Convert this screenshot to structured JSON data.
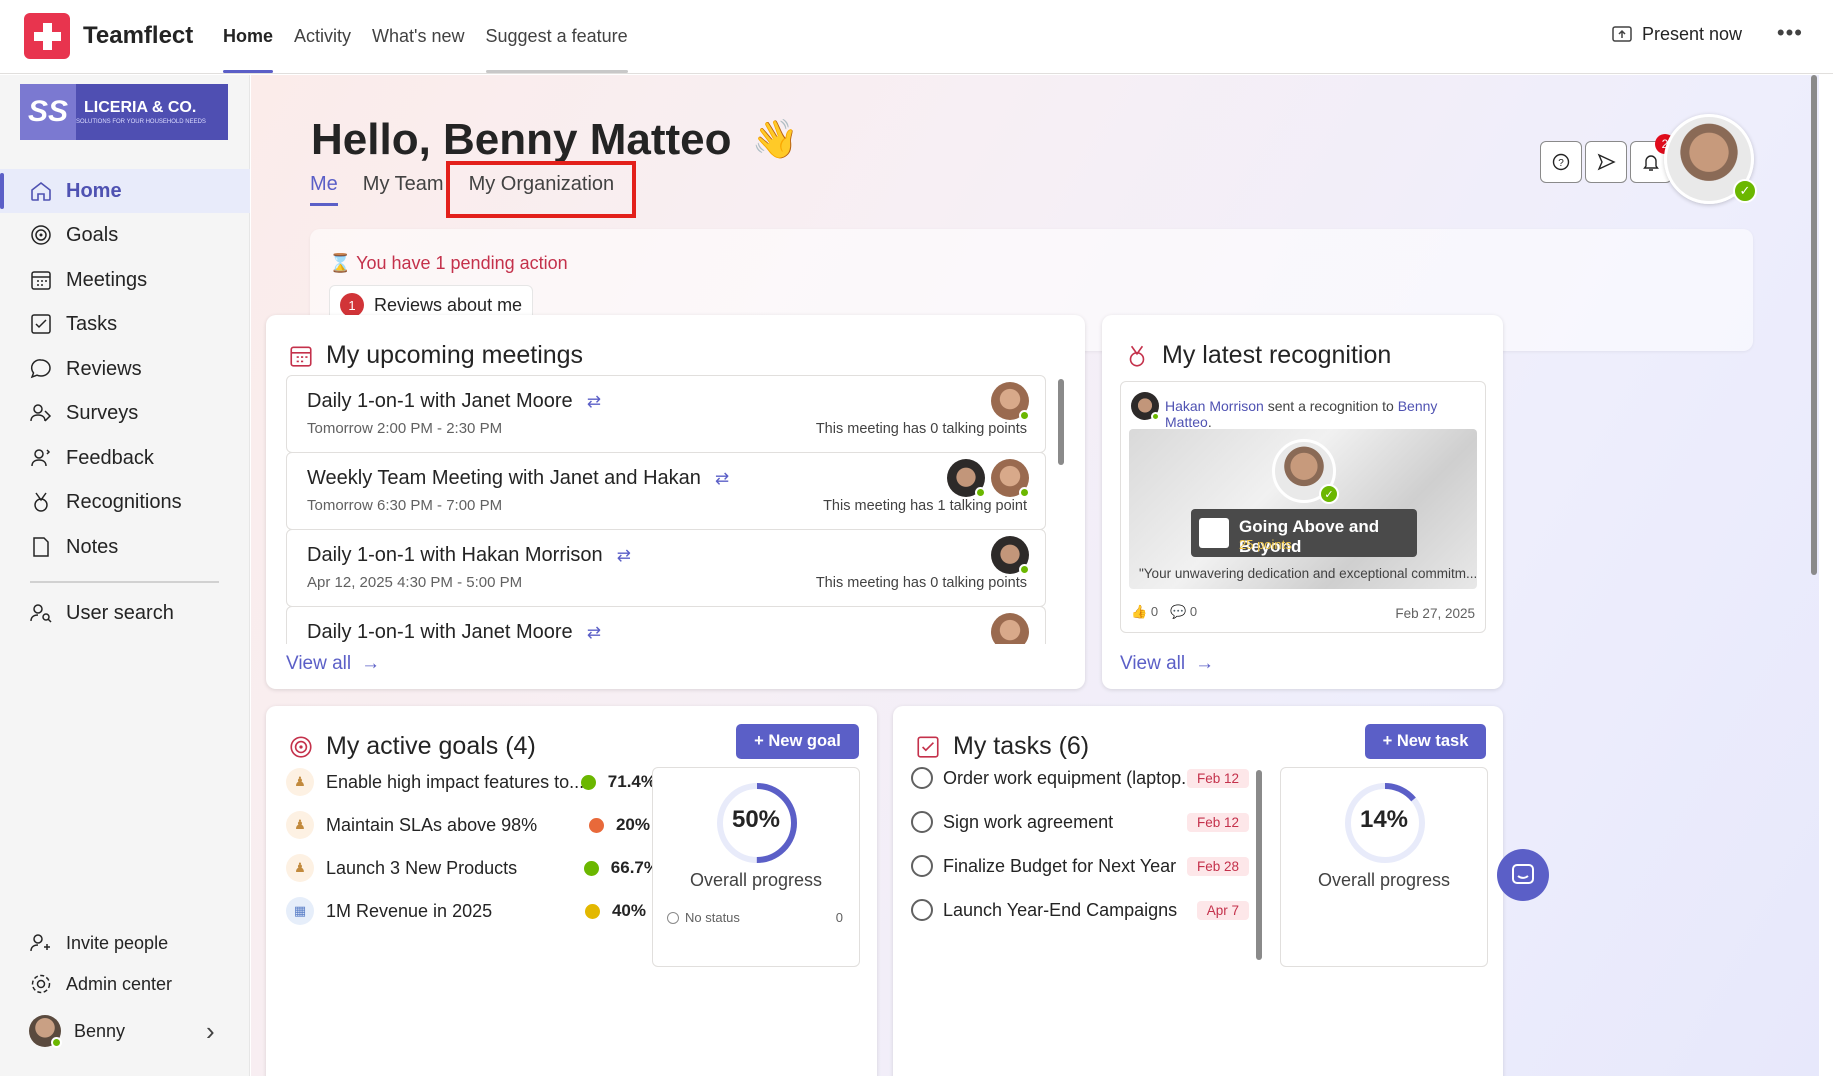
{
  "app": {
    "name": "Teamflect"
  },
  "topnav": {
    "items": [
      "Home",
      "Activity",
      "What's new",
      "Suggest a feature"
    ],
    "present": "Present now",
    "more": "•••"
  },
  "org": {
    "initials": "SS",
    "name": "LICERIA & CO.",
    "tagline": "SOLUTIONS FOR YOUR HOUSEHOLD NEEDS"
  },
  "sidebar": {
    "items": [
      "Home",
      "Goals",
      "Meetings",
      "Tasks",
      "Reviews",
      "Surveys",
      "Feedback",
      "Recognitions",
      "Notes"
    ],
    "user_search": "User search",
    "invite": "Invite people",
    "admin": "Admin center",
    "user": "Benny",
    "chevron": "›"
  },
  "header": {
    "greeting": "Hello, Benny Matteo",
    "wave": "👋",
    "tabs": [
      "Me",
      "My Team",
      "My Organization"
    ],
    "notifications": "2",
    "help": "?"
  },
  "pending": {
    "title": "You have 1 pending action",
    "count": "1",
    "label": "Reviews about me"
  },
  "meetings": {
    "title": "My upcoming meetings",
    "items": [
      {
        "title": "Daily 1-on-1 with Janet Moore",
        "time": "Tomorrow 2:00 PM - 2:30 PM",
        "note": "This meeting has 0 talking points"
      },
      {
        "title": "Weekly Team Meeting with Janet and Hakan",
        "time": "Tomorrow 6:30 PM - 7:00 PM",
        "note": "This meeting has 1 talking point"
      },
      {
        "title": "Daily 1-on-1 with Hakan Morrison",
        "time": "Apr 12, 2025 4:30 PM - 5:00 PM",
        "note": "This meeting has 0 talking points"
      },
      {
        "title": "Daily 1-on-1 with Janet Moore",
        "time": "",
        "note": ""
      }
    ],
    "view_all": "View all",
    "arrow": "→"
  },
  "recognition": {
    "title": "My latest recognition",
    "sender": "Hakan Morrison",
    "middle": " sent a recognition to ",
    "recipient": "Benny Matteo",
    "end": ".",
    "badge_title": "Going Above and Beyond",
    "points": "25 points",
    "quote": "\"Your unwavering dedication and exceptional commitm...",
    "likes": "0",
    "comments": "0",
    "date": "Feb 27, 2025",
    "view_all": "View all"
  },
  "goals": {
    "title": "My active goals (4)",
    "new_label": "+ New goal",
    "items": [
      {
        "name": "Enable high impact features to...",
        "pct": "71.4%",
        "color": "#6bb700"
      },
      {
        "name": "Maintain SLAs above 98%",
        "pct": "20%",
        "color": "#e8693a"
      },
      {
        "name": "Launch 3 New Products",
        "pct": "66.7%",
        "color": "#6bb700"
      },
      {
        "name": "1M Revenue in 2025",
        "pct": "40%",
        "color": "#e3b800"
      }
    ],
    "overall": "50%",
    "overall_value": 0.5,
    "overall_label": "Overall progress",
    "status_label": "No status",
    "status_count": "0"
  },
  "tasks": {
    "title": "My tasks (6)",
    "new_label": "+ New task",
    "items": [
      {
        "name": "Order work equipment (laptop...",
        "due": "Feb 12"
      },
      {
        "name": "Sign work agreement",
        "due": "Feb 12"
      },
      {
        "name": "Finalize Budget for Next Year",
        "due": "Feb 28"
      },
      {
        "name": "Launch Year-End Campaigns",
        "due": "Apr 7"
      }
    ],
    "overall": "14%",
    "overall_value": 0.14,
    "overall_label": "Overall progress"
  },
  "colors": {
    "accent": "#5b5fc7",
    "brand": "#e8344e",
    "alert": "#c4314b",
    "highlight": "#e3201b"
  }
}
